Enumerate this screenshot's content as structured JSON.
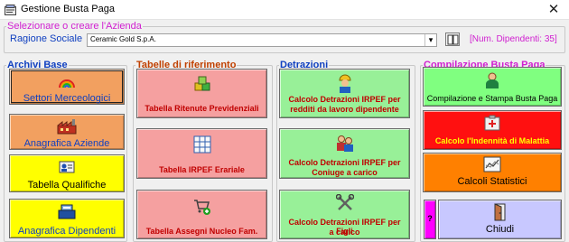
{
  "window": {
    "title": "Gestione Busta Paga",
    "close": "✕"
  },
  "azienda": {
    "legend": "Selezionare o creare l'Azienda",
    "ragione_label": "Ragione Sociale",
    "combo_value": "Ceramic Gold S.p.A.",
    "combo_arrow": "▾",
    "dipendenti": "[Num. Dipendenti: 35]"
  },
  "archivi": {
    "legend": "Archivi Base",
    "settori": "Settori Merceologici",
    "aziende": "Anagrafica Aziende",
    "qualifiche": "Tabella Qualifiche",
    "dipendenti": "Anagrafica Dipendenti"
  },
  "tabelle": {
    "legend": "Tabelle di riferimento",
    "ritenute": "Tabella Ritenute Previdenziali",
    "irpef": "Tabella IRPEF Erariale",
    "assegni": "Tabella Assegni Nucleo Fam."
  },
  "detrazioni": {
    "legend": "Detrazioni",
    "lavoro_l1": "Calcolo Detrazioni IRPEF per",
    "lavoro_l2": "redditi da lavoro dipendente",
    "coniuge_l1": "Calcolo Detrazioni IRPEF per",
    "coniuge_l2": "Coniuge a carico",
    "figli_l1": "Calcolo Detrazioni IRPEF per Figli",
    "figli_l2": "a carico"
  },
  "compilazione": {
    "legend": "Compilazione Busta Paga",
    "stampa": "Compilazione e Stampa Busta Paga",
    "malattia": "Calcolo l'Indennità di Malattia",
    "statistici": "Calcoli Statistici",
    "help": "?",
    "chiudi": "Chiudi"
  },
  "colors": {
    "orange": "#f2a060",
    "yellow": "#ffff00",
    "pink": "#f5a0a0",
    "green_light": "#98f098",
    "green": "#80ff80",
    "red": "#ff1010",
    "orange_bright": "#ff8000",
    "magenta": "#ff00ff",
    "lavender": "#c8c8ff"
  },
  "icons": [
    "app-icon",
    "close-icon",
    "chevron-down-icon",
    "book-icon",
    "rainbow-icon",
    "factory-icon",
    "id-card-icon",
    "cash-register-icon",
    "cubes-icon",
    "grid-table-icon",
    "cart-add-icon",
    "worker-icon",
    "couple-icon",
    "tools-icon",
    "person-icon",
    "first-aid-icon",
    "chart-icon",
    "exit-door-icon"
  ]
}
